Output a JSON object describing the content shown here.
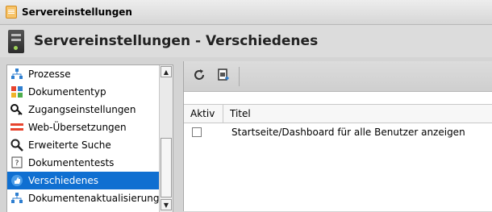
{
  "window": {
    "title": "Servereinstellungen"
  },
  "header": {
    "title": "Servereinstellungen - Verschiedenes",
    "icon": "server-icon"
  },
  "sidebar": {
    "items": [
      {
        "label": "Prozesse",
        "icon": "workflow-icon"
      },
      {
        "label": "Dokumententyp",
        "icon": "blocks-icon"
      },
      {
        "label": "Zugangseinstellungen",
        "icon": "key-icon"
      },
      {
        "label": "Web-Übersetzungen",
        "icon": "flag-icon"
      },
      {
        "label": "Erweiterte Suche",
        "icon": "magnifier-icon"
      },
      {
        "label": "Dokumententests",
        "icon": "question-icon"
      },
      {
        "label": "Verschiedenes",
        "icon": "thumbs-up-icon",
        "selected": true
      },
      {
        "label": "Dokumentenaktualisierungen",
        "icon": "workflow-icon"
      }
    ]
  },
  "toolbar": {
    "buttons": [
      "refresh-icon",
      "export-icon"
    ]
  },
  "table": {
    "columns": [
      "Aktiv",
      "Titel"
    ],
    "rows": [
      {
        "aktiv": false,
        "titel": "Startseite/Dashboard für alle Benutzer anzeigen"
      }
    ]
  },
  "colors": {
    "selection": "#0f6fd1",
    "background": "#d4d4d4"
  }
}
